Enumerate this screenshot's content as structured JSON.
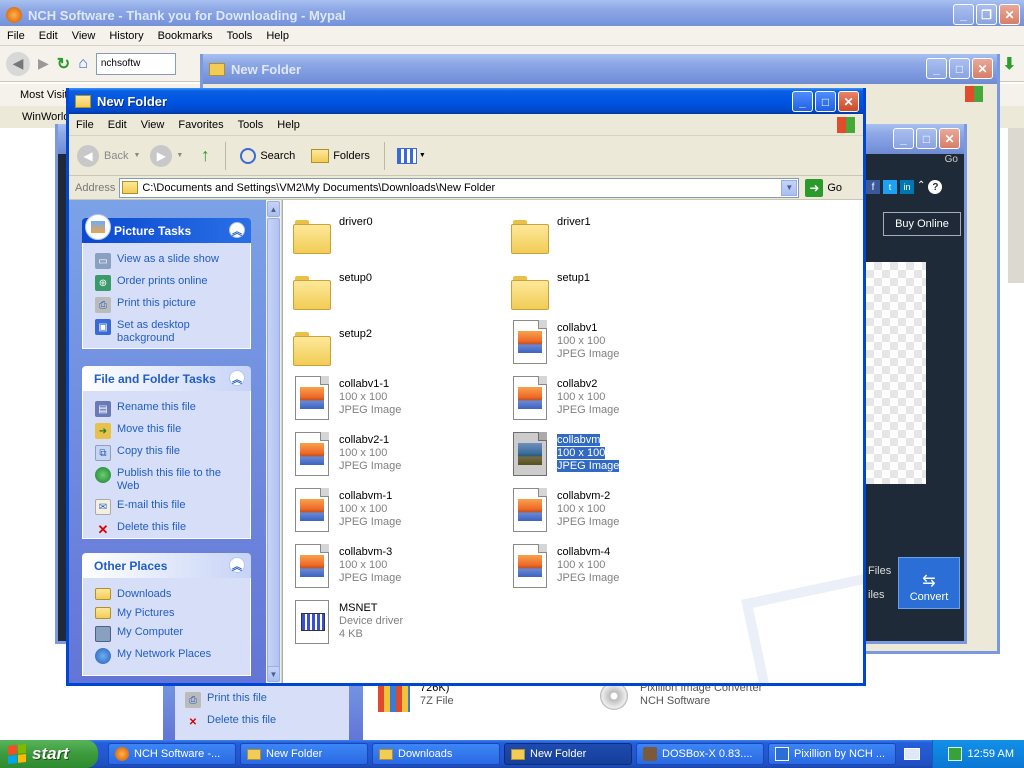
{
  "firefox": {
    "title": "NCH Software - Thank you for Downloading - Mypal",
    "menus": [
      "File",
      "Edit",
      "View",
      "History",
      "Bookmarks",
      "Tools",
      "Help"
    ],
    "url": "nchsoftw",
    "bookmarks": [
      "Most Visit",
      "WinWorld"
    ]
  },
  "bg_folder": {
    "title": "New Folder"
  },
  "pixillion": {
    "buy": "Buy Online",
    "convert": "Convert",
    "files_label": "Files",
    "files_label2": "iles",
    "go": "Go"
  },
  "downloads_win": {
    "print": "Print this file",
    "delete": "Delete this file",
    "item1_size": "726K)",
    "item1_type": "7Z File",
    "item2_name": "Pixillion Image Converter",
    "item2_company": "NCH Software"
  },
  "explorer": {
    "title": "New Folder",
    "menus": [
      "File",
      "Edit",
      "View",
      "Favorites",
      "Tools",
      "Help"
    ],
    "toolbar": {
      "back": "Back",
      "search": "Search",
      "folders": "Folders"
    },
    "address_label": "Address",
    "address": "C:\\Documents and Settings\\VM2\\My Documents\\Downloads\\New Folder",
    "go": "Go",
    "picture_tasks": {
      "title": "Picture Tasks",
      "items": [
        "View as a slide show",
        "Order prints online",
        "Print this picture",
        "Set as desktop background"
      ]
    },
    "file_tasks": {
      "title": "File and Folder Tasks",
      "items": [
        "Rename this file",
        "Move this file",
        "Copy this file",
        "Publish this file to the Web",
        "E-mail this file",
        "Delete this file"
      ]
    },
    "other_places": {
      "title": "Other Places",
      "items": [
        "Downloads",
        "My Pictures",
        "My Computer",
        "My Network Places"
      ]
    },
    "files": [
      {
        "name": "driver0",
        "kind": "folder"
      },
      {
        "name": "driver1",
        "kind": "folder"
      },
      {
        "name": "setup0",
        "kind": "folder"
      },
      {
        "name": "setup1",
        "kind": "folder"
      },
      {
        "name": "setup2",
        "kind": "folder"
      },
      {
        "name": "collabv1",
        "dims": "100 x 100",
        "type": "JPEG Image"
      },
      {
        "name": "collabv1-1",
        "dims": "100 x 100",
        "type": "JPEG Image"
      },
      {
        "name": "collabv2",
        "dims": "100 x 100",
        "type": "JPEG Image"
      },
      {
        "name": "collabv2-1",
        "dims": "100 x 100",
        "type": "JPEG Image"
      },
      {
        "name": "collabvm",
        "dims": "100 x 100",
        "type": "JPEG Image",
        "selected": true
      },
      {
        "name": "collabvm-1",
        "dims": "100 x 100",
        "type": "JPEG Image"
      },
      {
        "name": "collabvm-2",
        "dims": "100 x 100",
        "type": "JPEG Image"
      },
      {
        "name": "collabvm-3",
        "dims": "100 x 100",
        "type": "JPEG Image"
      },
      {
        "name": "collabvm-4",
        "dims": "100 x 100",
        "type": "JPEG Image"
      },
      {
        "name": "MSNET",
        "dims": "Device driver",
        "type": "4 KB"
      }
    ]
  },
  "taskbar": {
    "start": "start",
    "tasks": [
      "NCH Software -...",
      "New Folder",
      "Downloads",
      "New Folder",
      "DOSBox-X 0.83....",
      "Pixillion by NCH ..."
    ],
    "clock": "12:59 AM"
  }
}
